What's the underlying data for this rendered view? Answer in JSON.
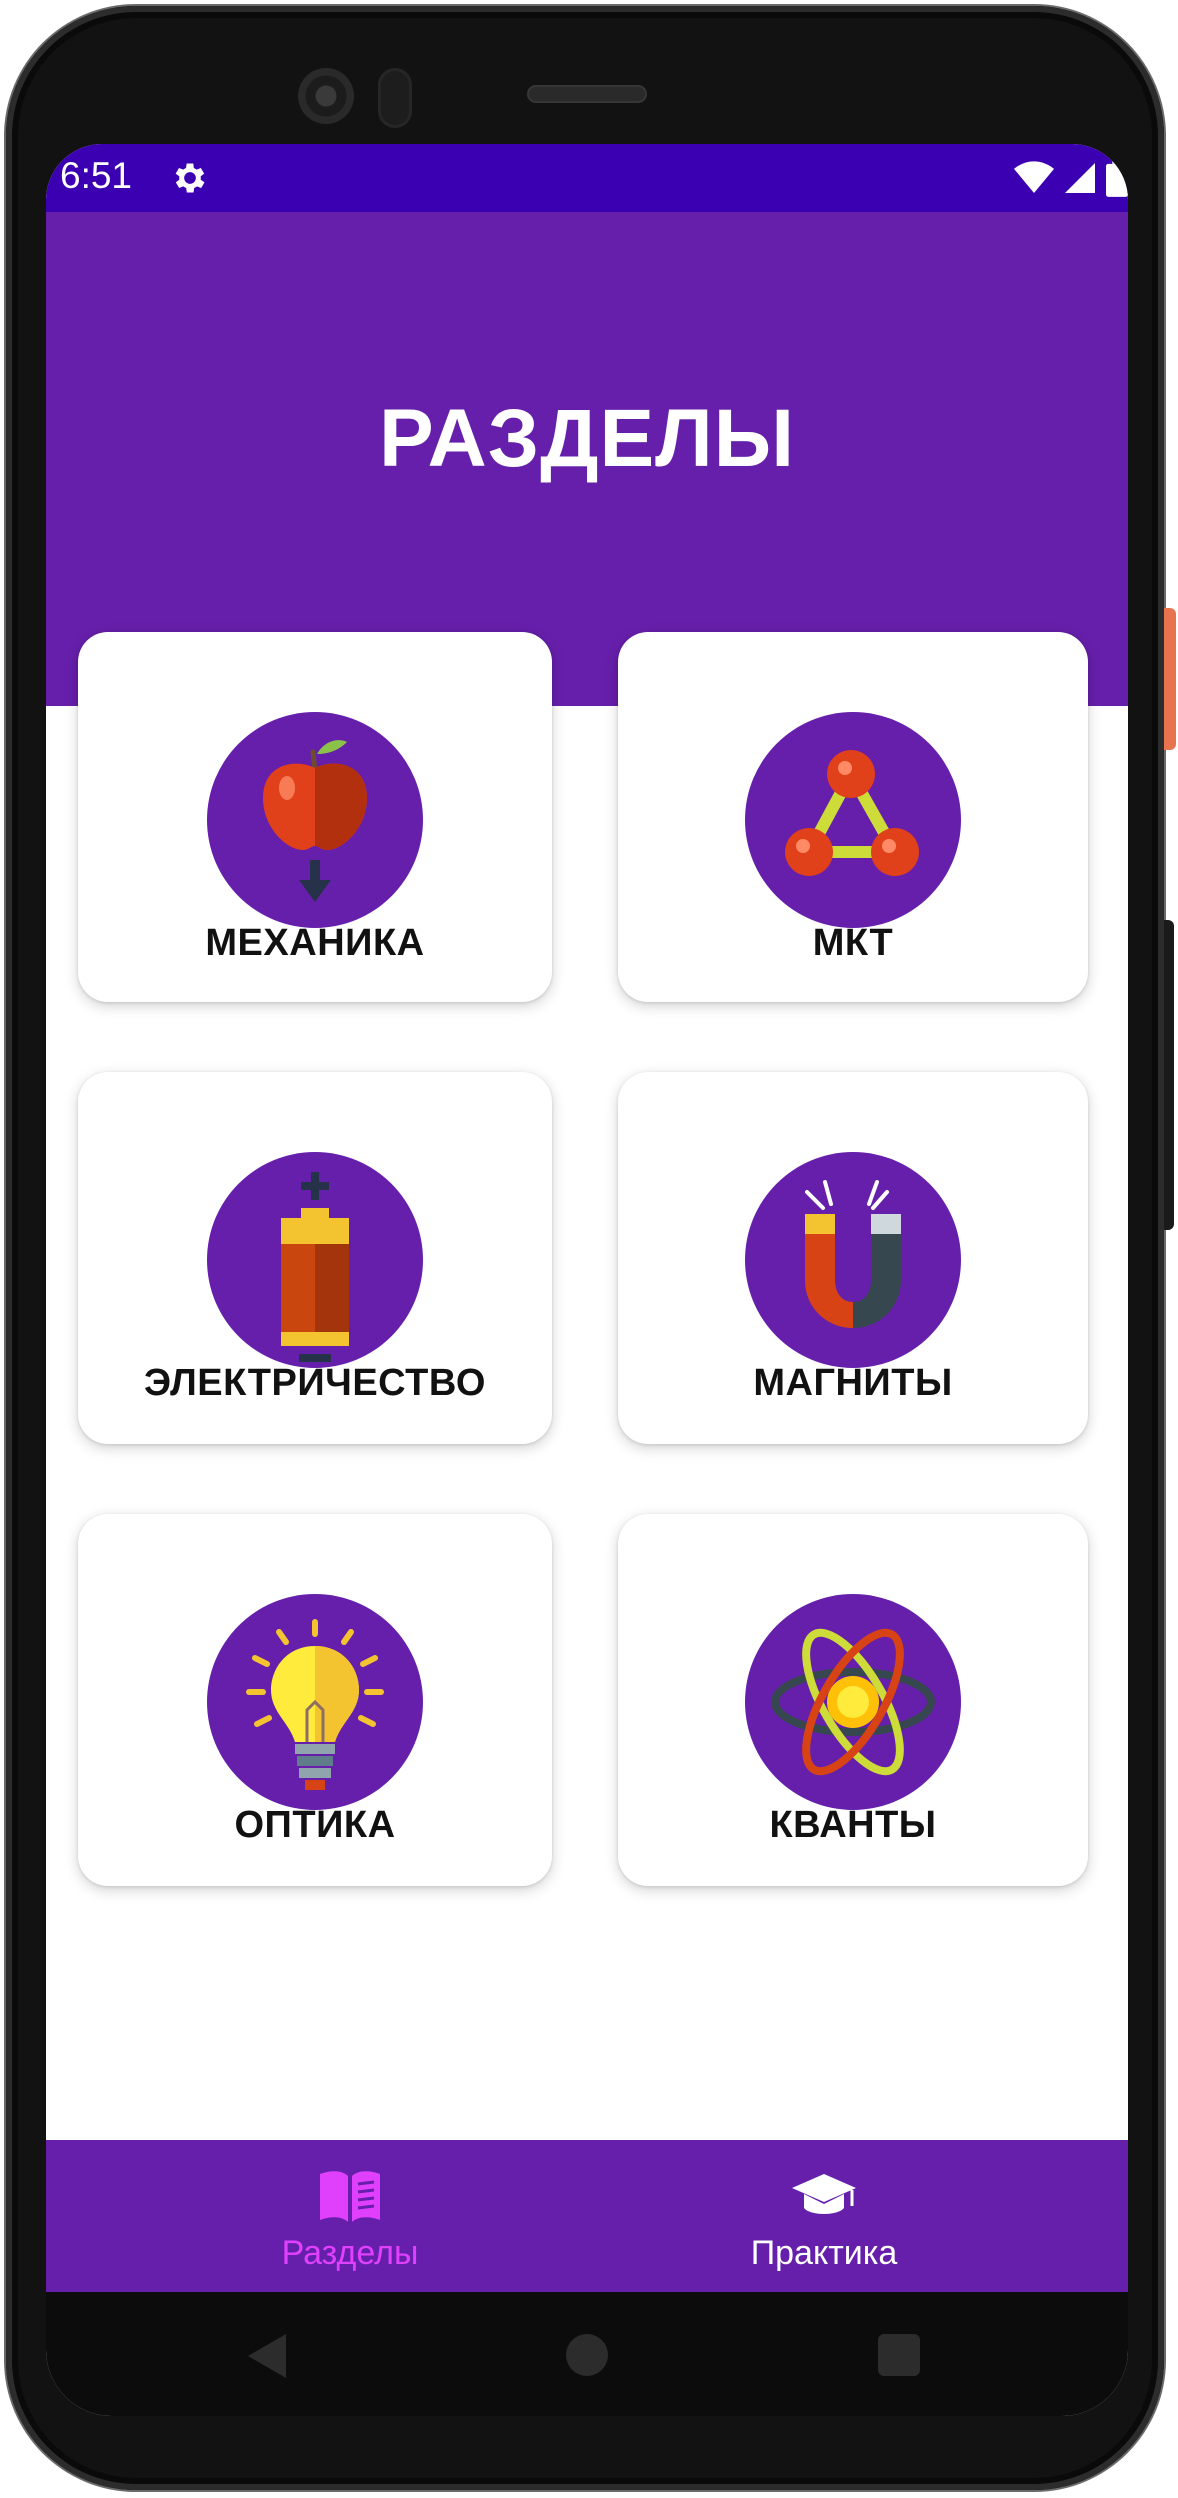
{
  "status_bar": {
    "time": "6:51",
    "icons": [
      "gear-icon",
      "wifi-icon",
      "signal-icon",
      "battery-icon"
    ]
  },
  "header": {
    "title": "РАЗДЕЛЫ"
  },
  "sections": [
    {
      "label": "МЕХАНИКА",
      "icon": "apple-falling-icon"
    },
    {
      "label": "МКТ",
      "icon": "molecule-icon"
    },
    {
      "label": "ЭЛЕКТРИЧЕСТВО",
      "icon": "battery-icon"
    },
    {
      "label": "МАГНИТЫ",
      "icon": "magnet-icon"
    },
    {
      "label": "ОПТИКА",
      "icon": "light-bulb-icon"
    },
    {
      "label": "КВАНТЫ",
      "icon": "atom-icon"
    }
  ],
  "bottom_nav": {
    "items": [
      {
        "label": "Разделы",
        "icon": "book-icon",
        "active": true
      },
      {
        "label": "Практика",
        "icon": "graduation-cap-icon",
        "active": false
      }
    ]
  },
  "colors": {
    "primary": "#661fab",
    "status_bar": "#3c00b3",
    "nav_active": "#e040fb",
    "nav_inactive": "#ffffff"
  }
}
